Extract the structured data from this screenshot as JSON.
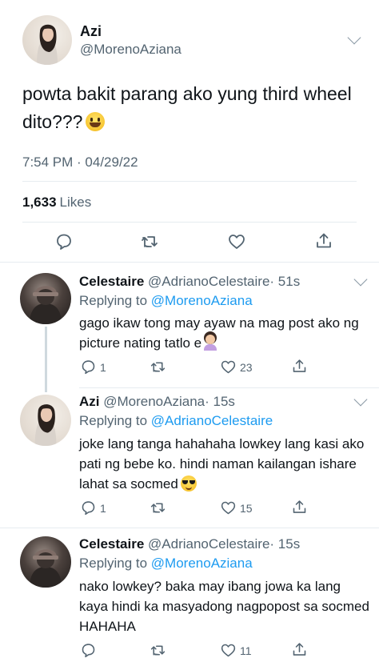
{
  "main_tweet": {
    "author_name": "Azi",
    "author_handle": "@MorenoAziana",
    "text": "powta bakit parang ako yung third wheel dito???",
    "timestamp": "7:54 PM · 04/29/22",
    "likes_count": "1,633",
    "likes_label": "Likes"
  },
  "replies": [
    {
      "author_name": "Celestaire",
      "author_handle": "@AdrianoCelestaire",
      "time": "· 51s",
      "replying_prefix": "Replying to",
      "replying_to": "@MorenoAziana",
      "text": "gago ikaw tong may ayaw na mag post ako ng picture nating tatlo e",
      "reply_count": "1",
      "retweet_count": "",
      "like_count": "23"
    },
    {
      "author_name": "Azi",
      "author_handle": "@MorenoAziana",
      "time": "· 15s",
      "replying_prefix": "Replying to",
      "replying_to": "@AdrianoCelestaire",
      "text": "joke lang tanga hahahaha lowkey lang kasi ako pati ng bebe ko. hindi naman kailangan ishare lahat sa socmed",
      "reply_count": "1",
      "retweet_count": "",
      "like_count": "15"
    },
    {
      "author_name": "Celestaire",
      "author_handle": "@AdrianoCelestaire",
      "time": "· 15s",
      "replying_prefix": "Replying to",
      "replying_to": "@MorenoAziana",
      "text": "nako lowkey? baka may ibang jowa ka lang kaya hindi ka masyadong nagpopost sa socmed HAHAHA",
      "reply_count": "",
      "retweet_count": "",
      "like_count": "11"
    }
  ],
  "icons": {
    "reply": "comment-bubble-icon",
    "retweet": "retweet-icon",
    "like": "heart-icon",
    "share": "share-icon",
    "more": "chevron-down-icon"
  },
  "colors": {
    "link": "#1d9bf0",
    "secondary_text": "#536471",
    "primary_text": "#0f1419",
    "divider": "#e6ecf0"
  }
}
